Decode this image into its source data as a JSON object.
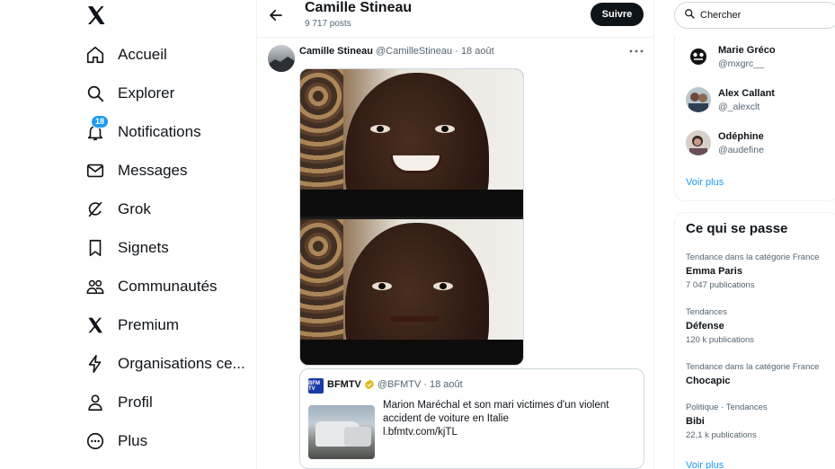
{
  "nav": {
    "items": [
      {
        "label": "Accueil",
        "icon": "home-icon"
      },
      {
        "label": "Explorer",
        "icon": "search-icon"
      },
      {
        "label": "Notifications",
        "icon": "bell-icon",
        "badge": "18"
      },
      {
        "label": "Messages",
        "icon": "envelope-icon"
      },
      {
        "label": "Grok",
        "icon": "grok-icon"
      },
      {
        "label": "Signets",
        "icon": "bookmark-icon"
      },
      {
        "label": "Communautés",
        "icon": "communities-icon"
      },
      {
        "label": "Premium",
        "icon": "x-logo-icon"
      },
      {
        "label": "Organisations ce...",
        "icon": "lightning-icon"
      },
      {
        "label": "Profil",
        "icon": "person-icon"
      },
      {
        "label": "Plus",
        "icon": "more-circle-icon"
      }
    ]
  },
  "header": {
    "name": "Camille Stineau",
    "post_count": "9 717 posts",
    "follow_label": "Suivre"
  },
  "tweet": {
    "author": "Camille Stineau",
    "handle": "@CamilleStineau",
    "separator": "·",
    "date": "18 août",
    "quote": {
      "logo_text": "BFM TV",
      "author": "BFMTV",
      "handle": "@BFMTV",
      "separator": "·",
      "date": "18 août",
      "text": "Marion Maréchal et son mari victimes d'un violent accident de voiture en Italie",
      "link": "l.bfmtv.com/kjTL"
    }
  },
  "search": {
    "placeholder": "Chercher"
  },
  "who_to_follow": {
    "users": [
      {
        "name": "Marie Gréco",
        "handle": "@mxgrc__"
      },
      {
        "name": "Alex Callant",
        "handle": "@_alexclt"
      },
      {
        "name": "Odéphine",
        "handle": "@audefine"
      }
    ],
    "see_more": "Voir plus"
  },
  "trends": {
    "title": "Ce qui se passe",
    "items": [
      {
        "context": "Tendance dans la catégorie France",
        "name": "Emma Paris",
        "count": "7 047 publications"
      },
      {
        "context": "Tendances",
        "name": "Défense",
        "count": "120 k publications"
      },
      {
        "context": "Tendance dans la catégorie France",
        "name": "Chocapic",
        "count": ""
      },
      {
        "context": "Politique · Tendances",
        "name": "Bibi",
        "count": "22,1 k publications"
      }
    ],
    "see_more": "Voir plus"
  },
  "colors": {
    "accent": "#1d9bf0",
    "text": "#0f1419",
    "muted": "#536471",
    "border": "#eff3f4"
  }
}
